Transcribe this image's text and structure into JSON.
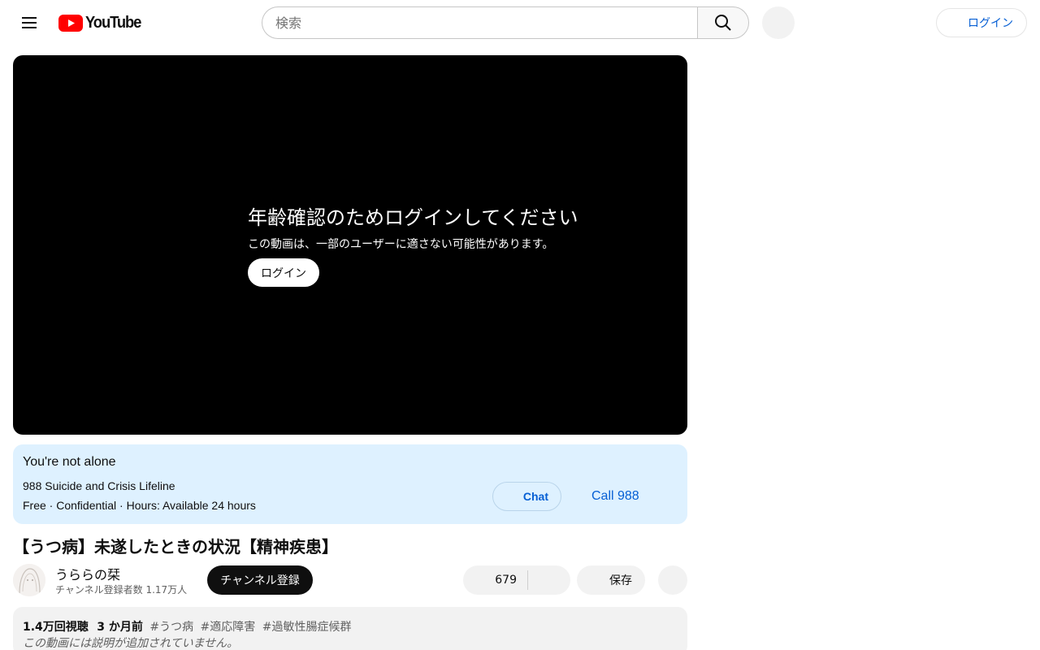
{
  "header": {
    "logo_text": "YouTube",
    "search_placeholder": "検索",
    "login_label": "ログイン"
  },
  "player": {
    "age_gate_title": "年齢確認のためログインしてください",
    "age_gate_message": "この動画は、一部のユーザーに適さない可能性があります。",
    "login_label": "ログイン"
  },
  "crisis_panel": {
    "title": "You're not alone",
    "organization": "988 Suicide and Crisis Lifeline",
    "details": "Free · Confidential · Hours: Available 24 hours",
    "chat_label": "Chat",
    "call_label": "Call 988"
  },
  "video": {
    "title": "【うつ病】未遂したときの状況【精神疾患】",
    "channel_name": "うららの栞",
    "subscriber_count": "チャンネル登録者数 1.17万人",
    "subscribe_label": "チャンネル登録",
    "like_count": "679",
    "save_label": "保存"
  },
  "description": {
    "views": "1.4万回視聴",
    "age": "3 か月前",
    "tags": [
      "#うつ病",
      "#適応障害",
      "#過敏性腸症候群"
    ],
    "empty_text": "この動画には説明が追加されていません。"
  },
  "colors": {
    "brand_red": "#ff0000",
    "link_blue": "#065fd4",
    "crisis_bg": "#def1ff"
  }
}
